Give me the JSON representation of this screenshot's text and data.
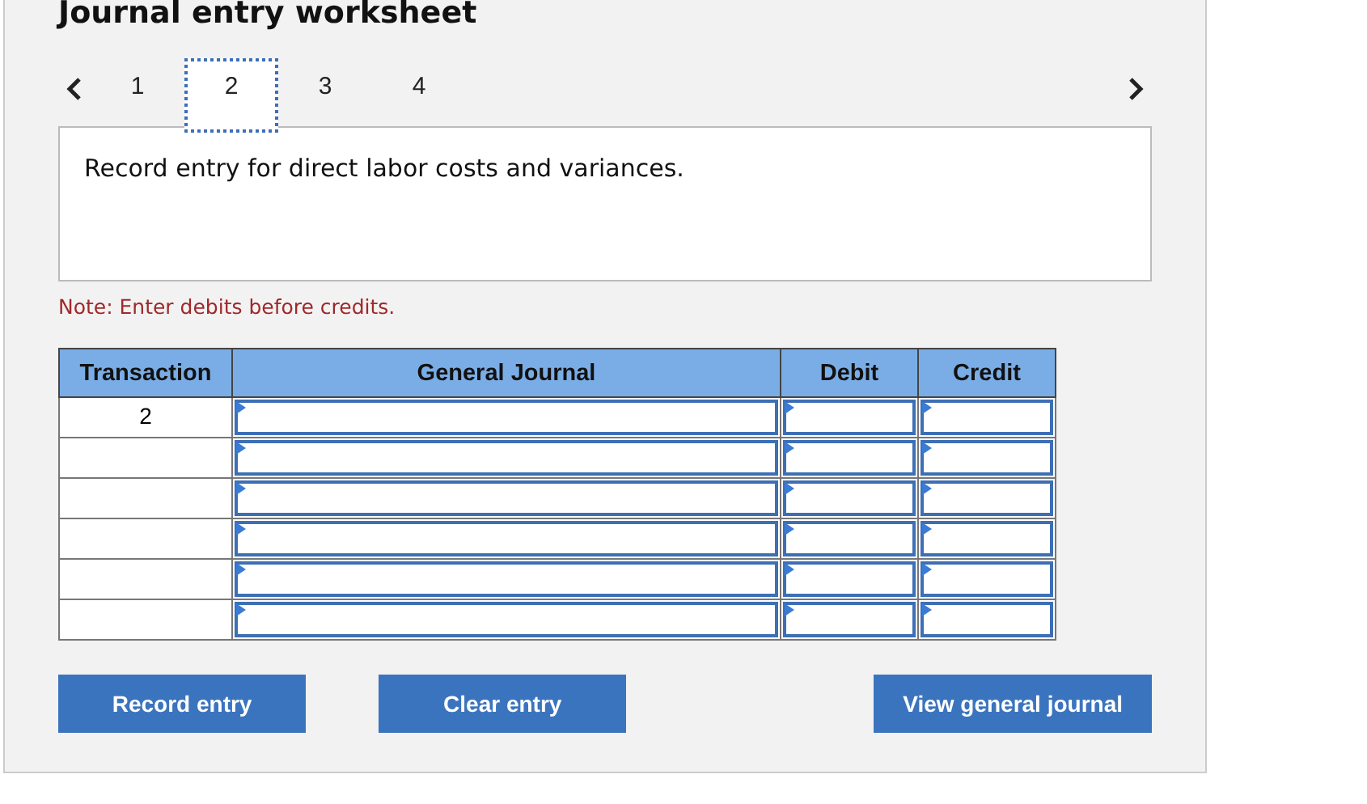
{
  "title": "Journal entry worksheet",
  "tabs": [
    {
      "label": "1",
      "selected": false
    },
    {
      "label": "2",
      "selected": true
    },
    {
      "label": "3",
      "selected": false
    },
    {
      "label": "4",
      "selected": false
    }
  ],
  "description": "Record entry for direct labor costs and variances.",
  "note": "Note: Enter debits before credits.",
  "table": {
    "columns": [
      "Transaction",
      "General Journal",
      "Debit",
      "Credit"
    ],
    "rows": [
      {
        "transaction": "2"
      },
      {},
      {},
      {},
      {},
      {}
    ]
  },
  "buttons": [
    "Record entry",
    "Clear entry",
    "View general journal"
  ]
}
